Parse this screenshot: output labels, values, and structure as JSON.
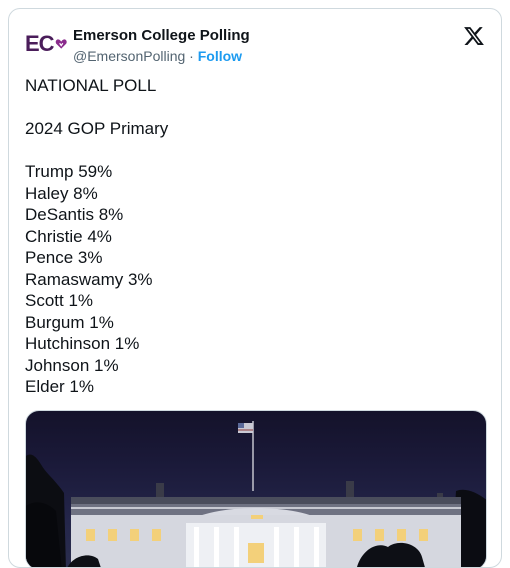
{
  "author": {
    "name": "Emerson College Polling",
    "handle": "@EmersonPolling",
    "separator": "·",
    "follow_label": "Follow",
    "logo_text": "EC"
  },
  "post": {
    "title": "NATIONAL POLL",
    "subtitle": "2024 GOP Primary",
    "results": [
      "Trump 59%",
      "Haley 8%",
      "DeSantis 8%",
      "Christie 4%",
      "Pence 3%",
      "Ramaswamy 3%",
      "Scott 1%",
      "Burgum 1%",
      "Hutchinson 1%",
      "Johnson 1%",
      "Elder 1%"
    ]
  },
  "media": {
    "description_icon": "white-house-night-photo"
  },
  "colors": {
    "link": "#1d9bf0",
    "brand": "#4a1d5a"
  }
}
